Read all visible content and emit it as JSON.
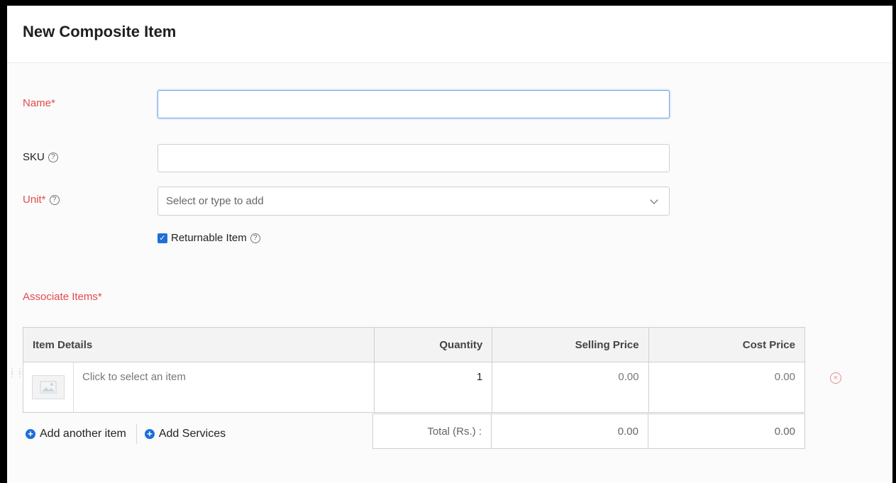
{
  "page": {
    "title": "New Composite Item"
  },
  "form": {
    "name_label": "Name*",
    "name_value": "",
    "sku_label": "SKU",
    "sku_value": "",
    "unit_label": "Unit*",
    "unit_placeholder": "Select or type to add",
    "returnable_label": "Returnable Item",
    "returnable_checked": true
  },
  "associate": {
    "label": "Associate Items*",
    "columns": [
      "Item Details",
      "Quantity",
      "Selling Price",
      "Cost Price"
    ],
    "rows": [
      {
        "item": "Click to select an item",
        "quantity": "1",
        "selling_price": "0.00",
        "cost_price": "0.00"
      }
    ],
    "add_another_item": "Add another item",
    "add_services": "Add Services",
    "total_label": "Total (Rs.) :",
    "total_selling": "0.00",
    "total_cost": "0.00"
  },
  "icons": {
    "help": "question-circle-icon",
    "dropdown": "chevron-down-icon",
    "remove": "remove-circle-icon",
    "add": "plus-circle-icon",
    "image": "image-placeholder-icon",
    "drag": "drag-handle-icon"
  }
}
